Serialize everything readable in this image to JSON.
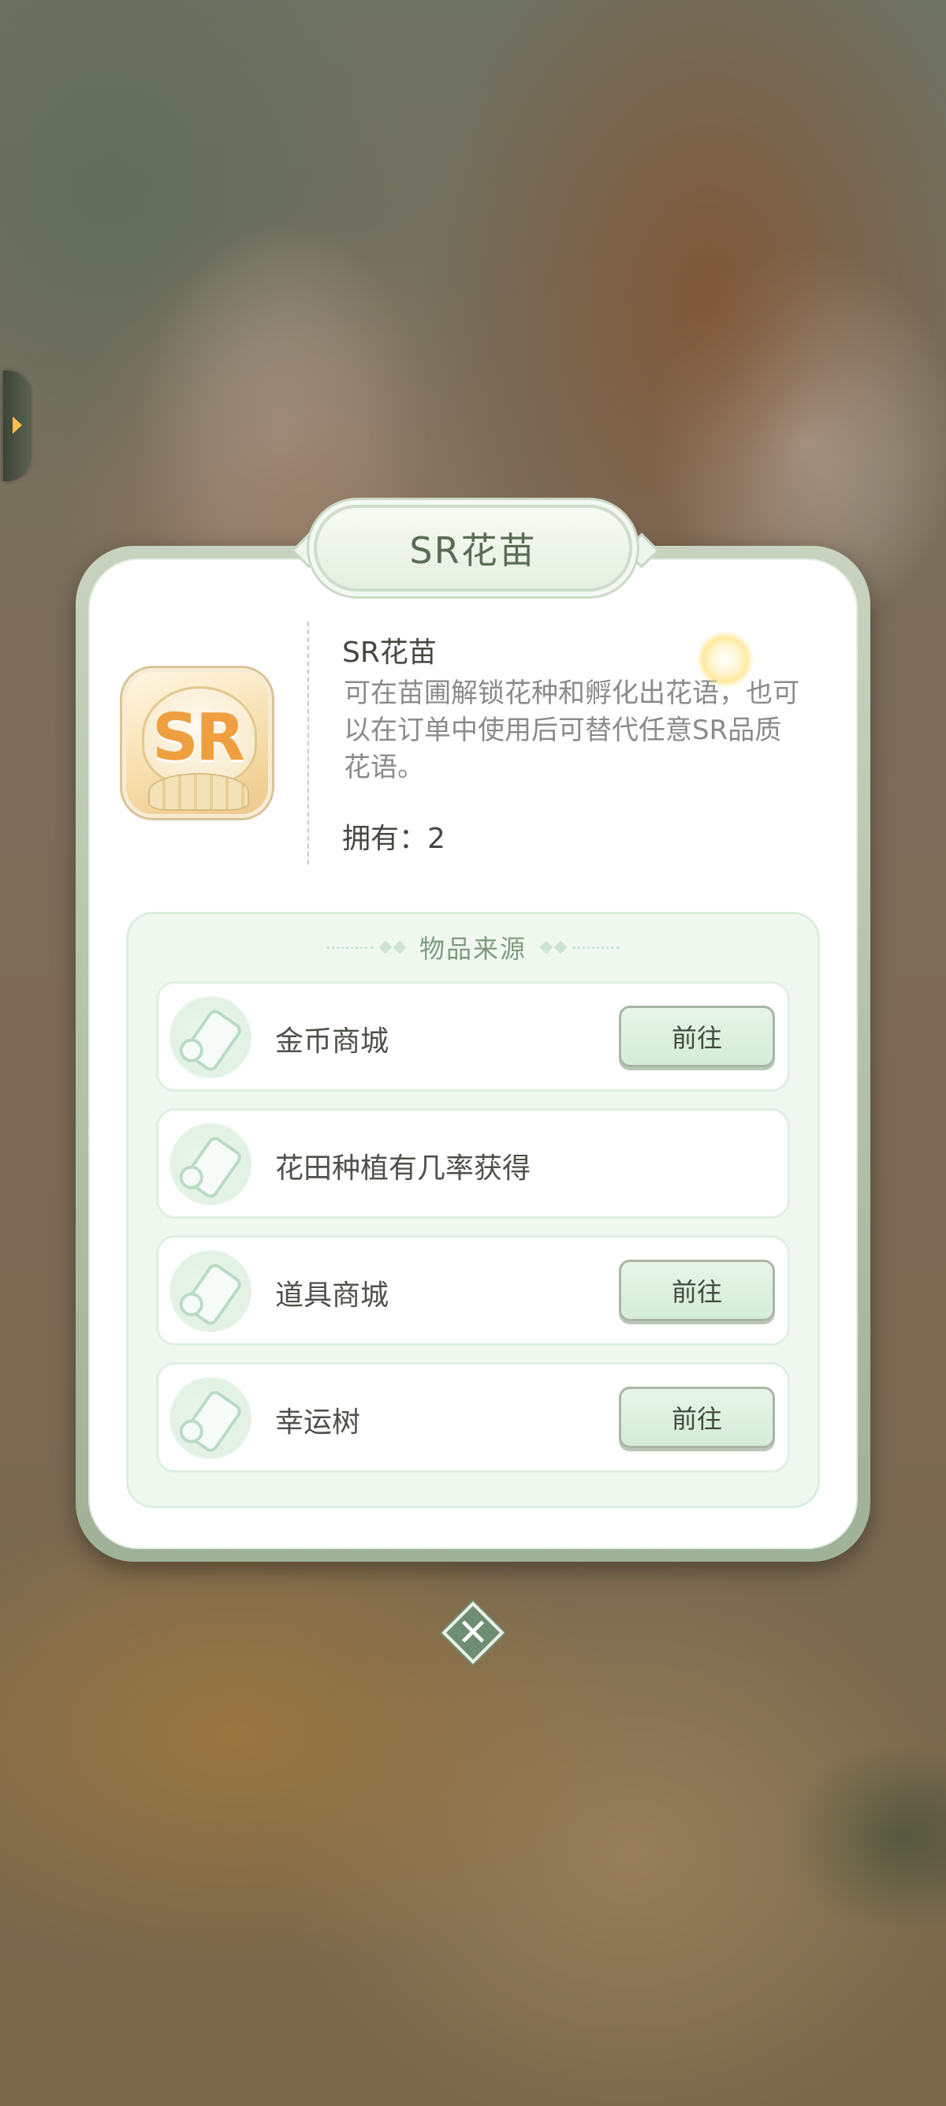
{
  "popup": {
    "title": "SR花苗",
    "item": {
      "icon_text": "SR",
      "name": "SR花苗",
      "description": "可在苗圃解锁花种和孵化出花语，也可以在订单中使用后可替代任意SR品质花语。",
      "owned": "拥有：2"
    },
    "sources": {
      "title": "物品来源",
      "items": [
        {
          "label": "金币商城",
          "button": "前往"
        },
        {
          "label": "花田种植有几率获得",
          "button": ""
        },
        {
          "label": "道具商城",
          "button": "前往"
        },
        {
          "label": "幸运树",
          "button": "前往"
        }
      ]
    },
    "close_glyph": "✕"
  },
  "colors": {
    "title_text": "#5b6c56",
    "accent_green": "#6f8d72",
    "sr_orange": "#ef9f3f",
    "button_bg": "#d6ecd9"
  }
}
